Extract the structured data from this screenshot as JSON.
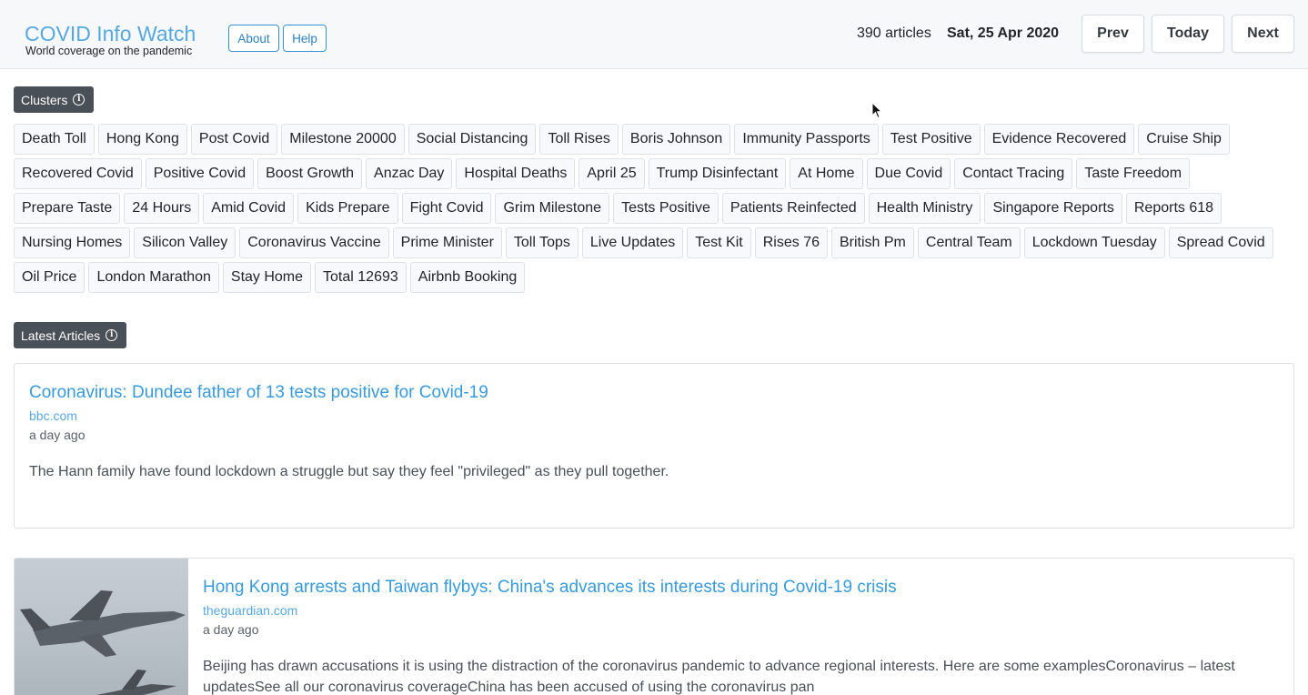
{
  "brand": {
    "title": "COVID Info Watch",
    "subtitle": "World coverage on the pandemic"
  },
  "nav": {
    "about": "About",
    "help": "Help"
  },
  "status": {
    "count": "390 articles",
    "date": "Sat, 25 Apr 2020"
  },
  "day_nav": {
    "prev": "Prev",
    "today": "Today",
    "next": "Next"
  },
  "clusters": {
    "label": "Clusters",
    "items": [
      "Death Toll",
      "Hong Kong",
      "Post Covid",
      "Milestone 20000",
      "Social Distancing",
      "Toll Rises",
      "Boris Johnson",
      "Immunity Passports",
      "Test Positive",
      "Evidence Recovered",
      "Cruise Ship",
      "Recovered Covid",
      "Positive Covid",
      "Boost Growth",
      "Anzac Day",
      "Hospital Deaths",
      "April 25",
      "Trump Disinfectant",
      "At Home",
      "Due Covid",
      "Contact Tracing",
      "Taste Freedom",
      "Prepare Taste",
      "24 Hours",
      "Amid Covid",
      "Kids Prepare",
      "Fight Covid",
      "Grim Milestone",
      "Tests Positive",
      "Patients Reinfected",
      "Health Ministry",
      "Singapore Reports",
      "Reports 618",
      "Nursing Homes",
      "Silicon Valley",
      "Coronavirus Vaccine",
      "Prime Minister",
      "Toll Tops",
      "Live Updates",
      "Test Kit",
      "Rises 76",
      "British Pm",
      "Central Team",
      "Lockdown Tuesday",
      "Spread Covid",
      "Oil Price",
      "London Marathon",
      "Stay Home",
      "Total 12693",
      "Airbnb Booking"
    ]
  },
  "articles_section": {
    "label": "Latest Articles"
  },
  "articles": [
    {
      "title": "Coronavirus: Dundee father of 13 tests positive for Covid-19",
      "source": "bbc.com",
      "time": "a day ago",
      "description": "The Hann family have found lockdown a struggle but say they feel \"privileged\" as they pull together."
    },
    {
      "title": "Hong Kong arrests and Taiwan flybys: China's advances its interests during Covid-19 crisis",
      "source": "theguardian.com",
      "time": "a day ago",
      "description": "Beijing has drawn accusations it is using the distraction of the coronavirus pandemic to advance regional interests. Here are some examplesCoronavirus – latest updatesSee all our coronavirus coverageChina has been accused of using the coronavirus pan"
    }
  ]
}
